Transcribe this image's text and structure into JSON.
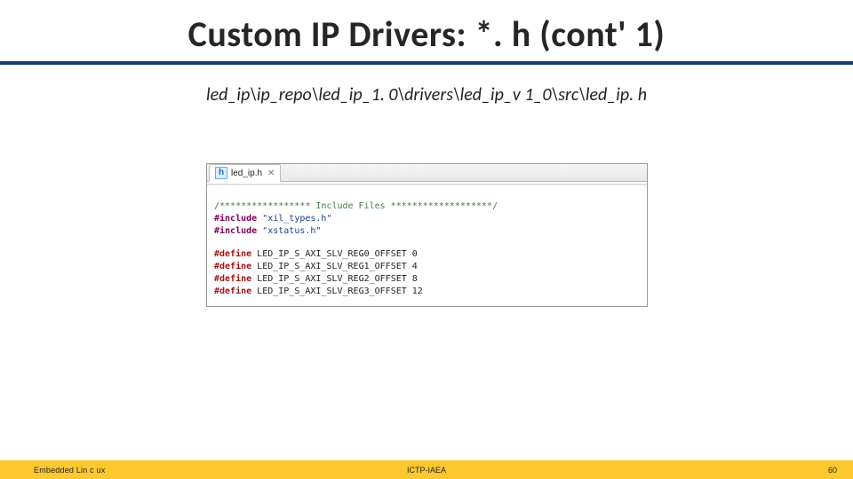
{
  "title": "Custom IP Drivers: *. h (cont' 1)",
  "path": "led_ip\\ip_repo\\led_ip_1. 0\\drivers\\led_ip_v 1_0\\src\\led_ip. h",
  "editor": {
    "tab": {
      "icon_letter": "h",
      "filename": "led_ip.h",
      "close": "✕"
    },
    "lines": [
      {
        "kind": "blank"
      },
      {
        "kind": "comment",
        "text": "/***************** Include Files *******************/"
      },
      {
        "kind": "include1",
        "kw": "#include",
        "val": "\"xil_types.h\""
      },
      {
        "kind": "include1",
        "kw": "#include",
        "val": "\"xstatus.h\""
      },
      {
        "kind": "blank"
      },
      {
        "kind": "define",
        "kw": "#define",
        "rest": " LED_IP_S_AXI_SLV_REG0_OFFSET 0"
      },
      {
        "kind": "define",
        "kw": "#define",
        "rest": " LED_IP_S_AXI_SLV_REG1_OFFSET 4"
      },
      {
        "kind": "define",
        "kw": "#define",
        "rest": " LED_IP_S_AXI_SLV_REG2_OFFSET 8"
      },
      {
        "kind": "define",
        "kw": "#define",
        "rest": " LED_IP_S_AXI_SLV_REG3_OFFSET 12"
      }
    ]
  },
  "footer": {
    "left": "Embedded Lin c ux",
    "mid": "ICTP-IAEA",
    "right": "60"
  }
}
